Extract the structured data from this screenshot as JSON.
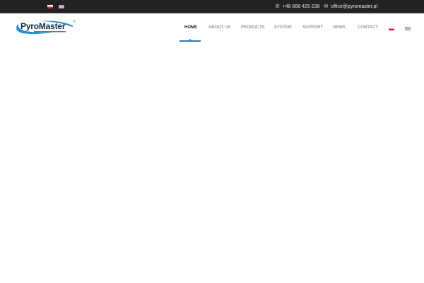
{
  "topbar": {
    "phone": "+48 668 425 238",
    "email": "office@pyromaster.pl",
    "languages": [
      "Polski",
      "English"
    ]
  },
  "logo": {
    "text": "PyroMaster"
  },
  "nav": {
    "items": [
      "HOME",
      "ABOUT US",
      "PRODUCTS",
      "SYSTEM",
      "SUPPORT",
      "NEWS",
      "CONTACT"
    ],
    "active": "HOME"
  },
  "colors": {
    "accent": "#2a7ab8",
    "topbar": "#222222"
  }
}
